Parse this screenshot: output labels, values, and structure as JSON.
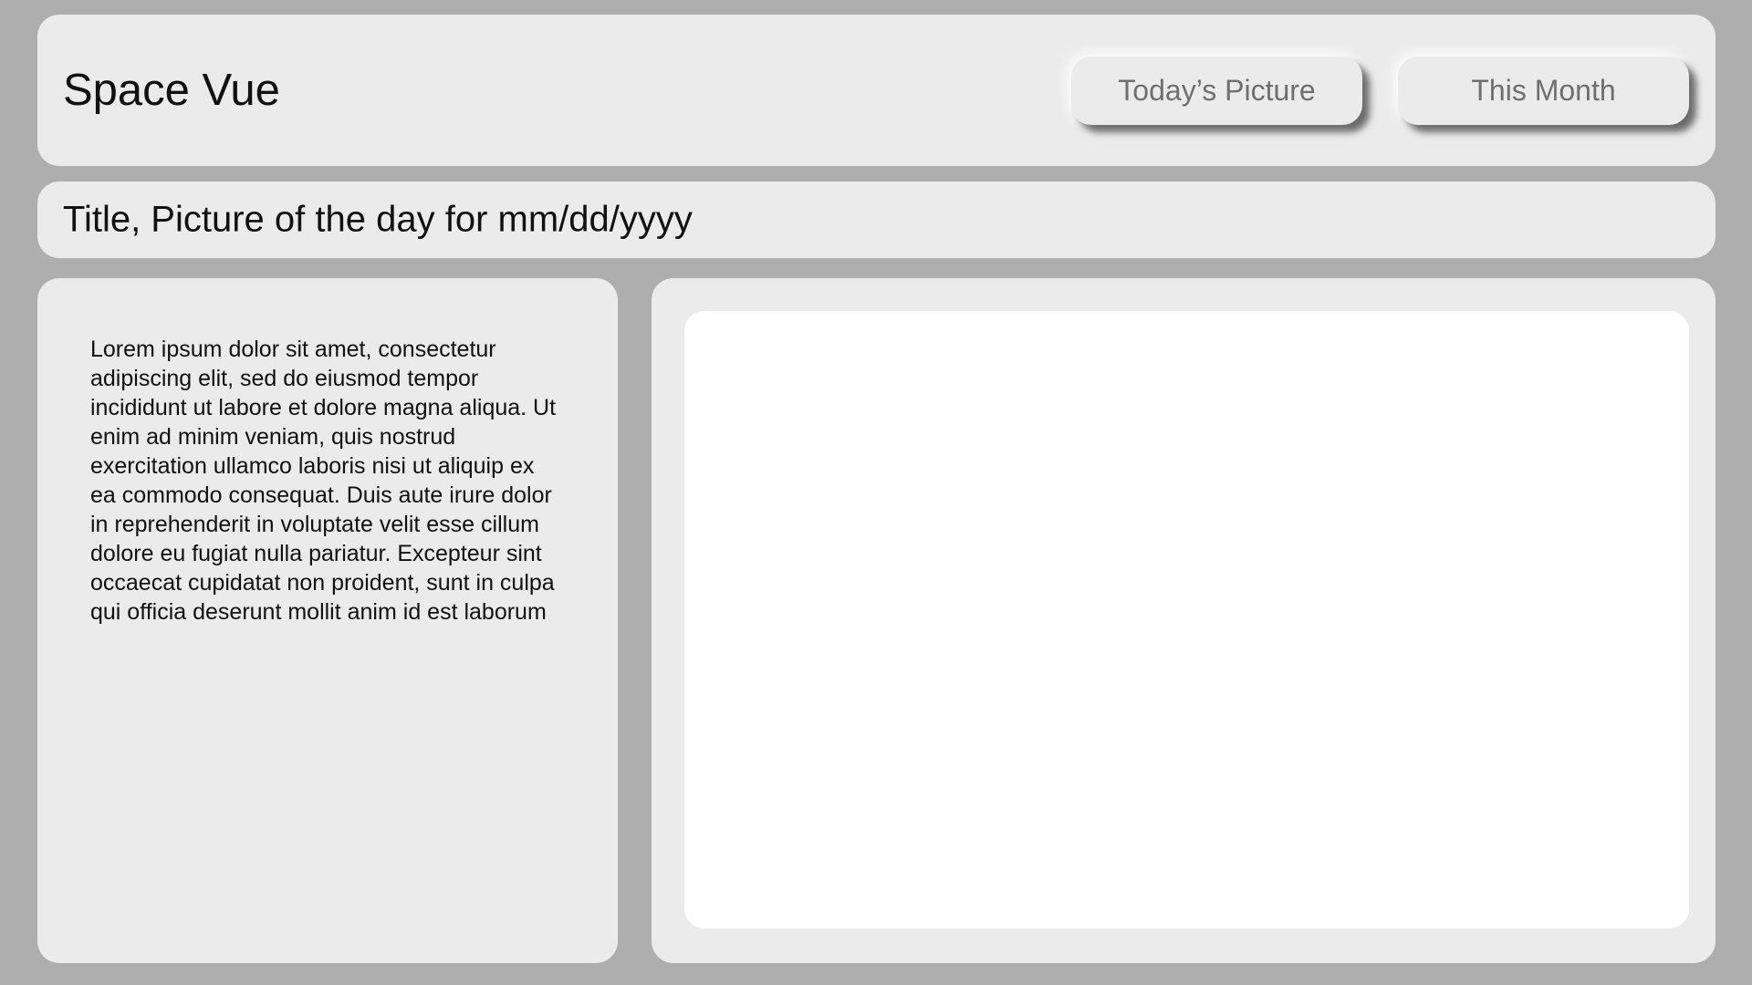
{
  "header": {
    "app_title": "Space Vue",
    "nav": {
      "todays_picture_label": "Today’s Picture",
      "this_month_label": "This Month"
    }
  },
  "title_bar": {
    "text": "Title, Picture of the day for mm/dd/yyyy"
  },
  "description": {
    "text": "Lorem ipsum dolor sit amet, consectetur adipiscing elit, sed do eiusmod tempor incididunt ut labore et dolore magna aliqua. Ut enim ad minim veniam, quis nostrud exercitation ullamco laboris nisi ut aliquip ex ea commodo consequat. Duis aute irure dolor in reprehenderit in voluptate velit esse cillum dolore eu fugiat nulla pariatur. Excepteur sint occaecat cupidatat non proident, sunt in culpa qui officia deserunt mollit anim id est laborum"
  },
  "colors": {
    "background": "#aeaeae",
    "panel": "#ebebeb",
    "image_placeholder": "#ffffff",
    "button_text": "#6f6f6f"
  }
}
